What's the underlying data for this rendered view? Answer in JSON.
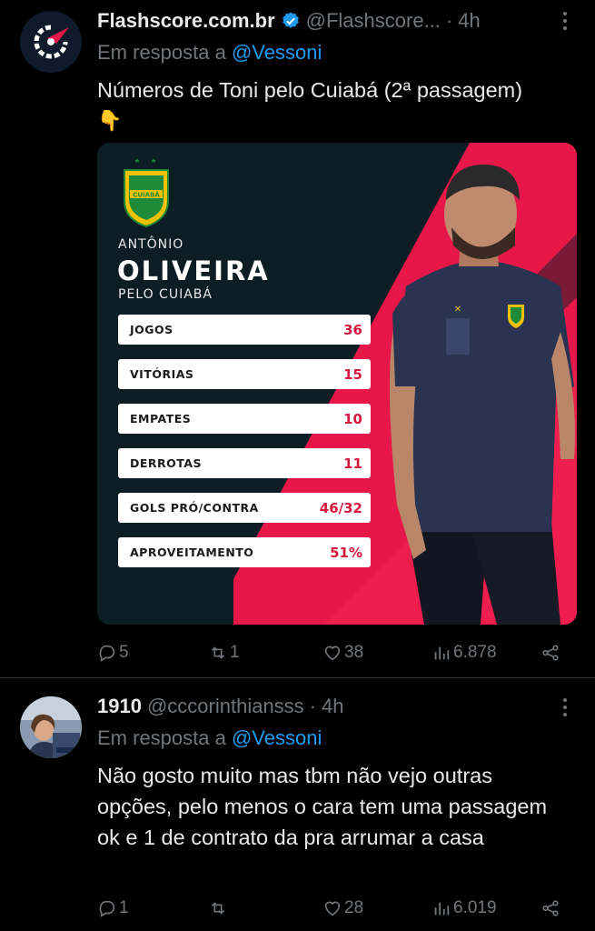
{
  "tweets": [
    {
      "author_name": "Flashscore.com.br",
      "verified": true,
      "handle": "@Flashscore...",
      "separator": "·",
      "time": "4h",
      "reply_prefix": "Em resposta a ",
      "reply_mention": "@Vessoni",
      "text_line1": "Números de Toni pelo Cuiabá (2ª passagem)",
      "text_line2": "👇",
      "graphic": {
        "first_name": "ANTÔNIO",
        "last_name": "OLIVEIRA",
        "subtitle": "PELO CUIABÁ",
        "crest_text": "CUIABÁ",
        "stats": [
          {
            "label": "JOGOS",
            "value": "36"
          },
          {
            "label": "VITÓRIAS",
            "value": "15"
          },
          {
            "label": "EMPATES",
            "value": "10"
          },
          {
            "label": "DERROTAS",
            "value": "11"
          },
          {
            "label": "GOLS PRÓ/CONTRA",
            "value": "46/32"
          },
          {
            "label": "APROVEITAMENTO",
            "value": "51%"
          }
        ]
      },
      "actions": {
        "replies": "5",
        "retweets": "1",
        "likes": "38",
        "views": "6.878"
      }
    },
    {
      "author_name": "1910",
      "verified": false,
      "handle": "@cccorinthiansss",
      "separator": "·",
      "time": "4h",
      "reply_prefix": "Em resposta a ",
      "reply_mention": "@Vessoni",
      "text": "Não gosto muito mas tbm não vejo outras opções, pelo menos o cara tem uma passagem ok e 1 de contrato da pra arrumar a casa",
      "actions": {
        "replies": "1",
        "retweets": "",
        "likes": "28",
        "views": "6.019"
      }
    }
  ],
  "colors": {
    "background": "#000000",
    "link": "#1d9bf0",
    "muted": "#71767b",
    "brand_red": "#e8174a",
    "brand_dark": "#0c1e24"
  }
}
